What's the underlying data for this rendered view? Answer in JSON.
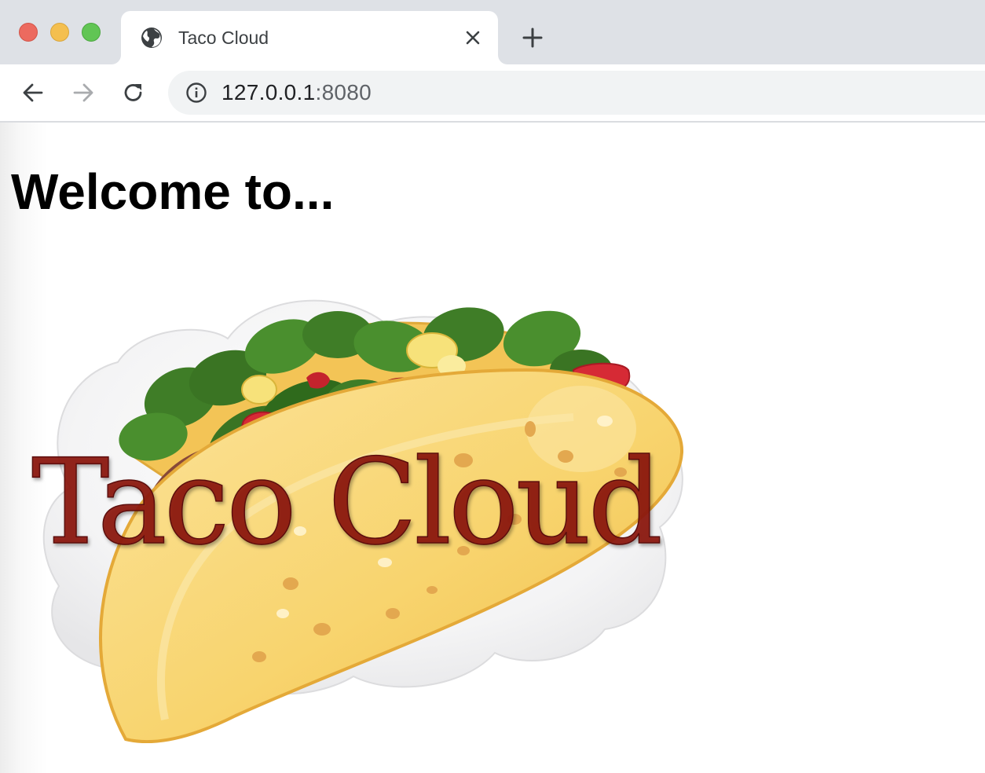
{
  "window": {
    "controls": [
      "close",
      "minimize",
      "maximize"
    ]
  },
  "tab": {
    "title": "Taco Cloud",
    "favicon": "globe-icon",
    "close_icon": "close-icon"
  },
  "new_tab_icon": "plus-icon",
  "toolbar": {
    "back_icon": "arrow-left-icon",
    "forward_icon": "arrow-right-icon",
    "reload_icon": "reload-icon",
    "site_info_icon": "info-icon",
    "url_host": "127.0.0.1",
    "url_port": ":8080"
  },
  "page": {
    "heading": "Welcome to...",
    "logo_text": "Taco Cloud"
  },
  "colors": {
    "tabstrip_bg": "#dee1e6",
    "omnibox_bg": "#f1f3f4",
    "logo_text": "#8b1a10",
    "taco_shell": "#f7d36b",
    "lettuce": "#3f7d27",
    "tomato": "#d62a35",
    "meat": "#6e3a2c"
  }
}
